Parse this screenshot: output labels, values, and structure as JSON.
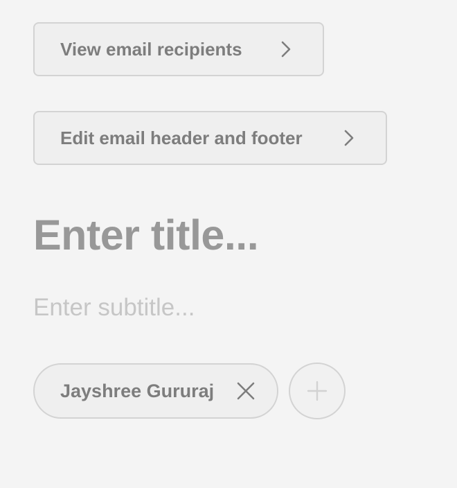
{
  "buttons": {
    "view_recipients_label": "View email recipients",
    "edit_header_footer_label": "Edit email header and footer"
  },
  "editor": {
    "title_placeholder": "Enter title...",
    "subtitle_placeholder": "Enter subtitle..."
  },
  "authors": {
    "chips": [
      {
        "name": "Jayshree Gururaj"
      }
    ]
  },
  "icons": {
    "nav": "chevron-right-icon",
    "remove": "close-icon",
    "add": "plus-icon"
  },
  "colors": {
    "background": "#f4f4f4",
    "button_bg": "#efefef",
    "border": "#d3d3d3",
    "button_text": "#7d7d7d",
    "title_placeholder": "#989898",
    "subtitle_placeholder": "#c6c6c6"
  }
}
